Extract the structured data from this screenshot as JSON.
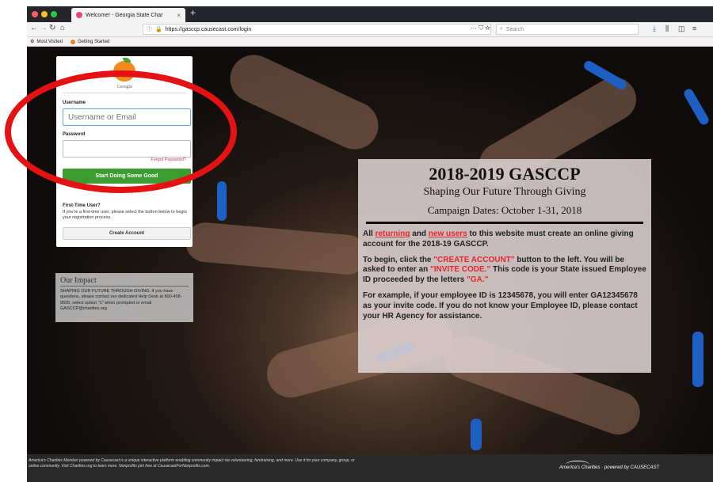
{
  "browser": {
    "tab_title": "Welcome! - Georgia State Char",
    "tab_close": "×",
    "new_tab": "+",
    "url": "https://gasccp.causecast.com/login",
    "url_actions": "··· ⛉ ☆",
    "search_placeholder": "Search",
    "bookmarks": [
      "Most Visited",
      "Getting Started"
    ]
  },
  "login": {
    "logo_text": "Georgia",
    "username_label": "Username",
    "username_placeholder": "Username or Email",
    "password_label": "Password",
    "forgot_link": "Forgot Password?",
    "start_button": "Start Doing Some Good",
    "first_time_heading": "First-Time User?",
    "first_time_text": "If you're a first-time user, please select the button below to begin your registration process.",
    "create_button": "Create Account"
  },
  "impact": {
    "heading": "Our Impact",
    "text": "SHAPING OUR FUTURE THROUGH GIVING. If you have questions, please contact our dedicated Help Desk at 800-458-9505, select option \"1\" when prompted or email GASCCP@charities.org"
  },
  "campaign": {
    "title": "2018-2019 GASCCP",
    "subtitle": "Shaping Our Future Through Giving",
    "dates": "Campaign Dates: October 1-31, 2018",
    "p1_a": "All ",
    "p1_returning": "returning",
    "p1_b": " and ",
    "p1_new": "new users",
    "p1_c": " to this website must create an online giving account for the 2018-19 GASCCP.",
    "p2_a": "To begin, click the ",
    "p2_create": "\"CREATE ACCOUNT\"",
    "p2_b": " button to the left. You will be asked to enter an ",
    "p2_invite": "\"INVITE CODE.\"",
    "p2_c": " This code is your State issued Employee ID proceeded by the letters ",
    "p2_ga": "\"GA.\"",
    "p3": "For example, if your employee ID is 12345678, you will enter GA12345678 as your invite code. If you do not know your Employee ID, please contact your HR Agency for assistance."
  },
  "footer": {
    "text": "America's Charities Member powered by Causecast is a unique interactive platform enabling community impact via volunteering, fundraising, and more. Use it for your company, group, or online community. Visit Charities.org to learn more. Nonprofits join free at CausecastForNonprofits.com.",
    "brand": "America's Charities · powered by CAUSECAST"
  },
  "colors": {
    "accent_green": "#3d9c2f",
    "link_pink": "#d02e6e",
    "annotation_red": "#e41212",
    "highlight_red": "#e8242e"
  }
}
